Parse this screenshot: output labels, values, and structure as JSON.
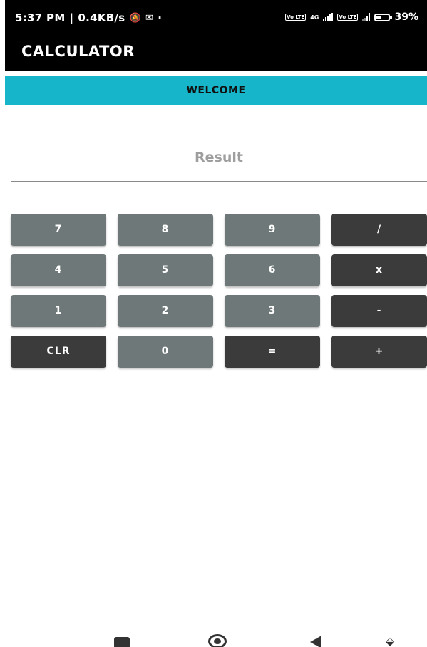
{
  "status_bar": {
    "time": "5:37 PM",
    "net_speed": "0.4KB/s",
    "separator": "|",
    "dot": "·",
    "sim1_volte": "Vo LTE",
    "network_type": "4G",
    "sim2_volte": "Vo LTE",
    "battery_percent": "39%",
    "battery_level": 0.39
  },
  "app_bar": {
    "title": "CALCULATOR"
  },
  "banner": {
    "text": "WELCOME"
  },
  "result_field": {
    "placeholder": "Result"
  },
  "keypad": {
    "rows": [
      [
        "7",
        "8",
        "9",
        "/"
      ],
      [
        "4",
        "5",
        "6",
        "x"
      ],
      [
        "1",
        "2",
        "3",
        "-"
      ],
      [
        "CLR",
        "0",
        "=",
        "+"
      ]
    ]
  },
  "colors": {
    "accent": "#16b5c9",
    "key_light": "#6e7878",
    "key_dark": "#3b3b3b",
    "bar": "#000000"
  },
  "nav_bar": {
    "icons": [
      "recents-icon",
      "home-icon",
      "back-icon",
      "assist-icon"
    ]
  }
}
